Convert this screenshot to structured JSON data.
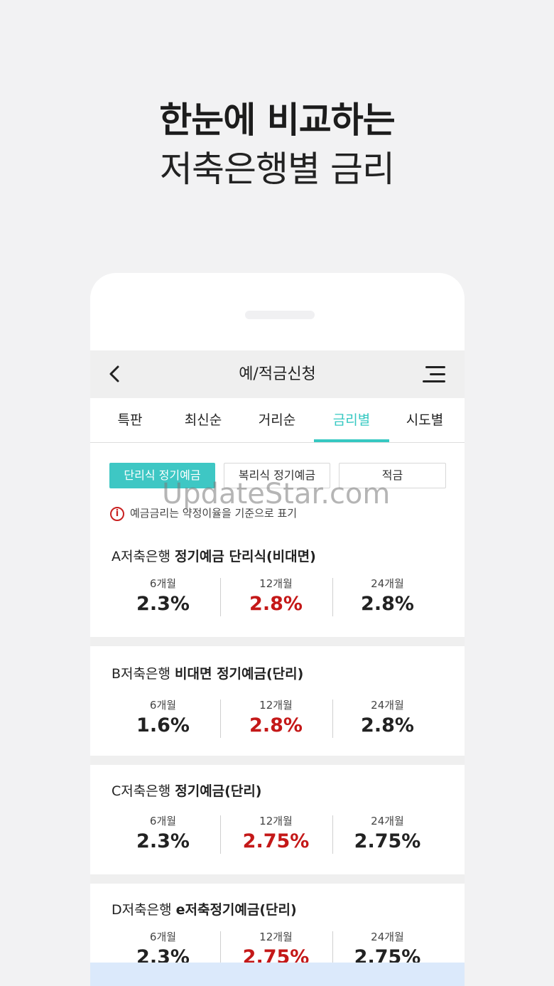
{
  "headline": {
    "line1": "한눈에 비교하는",
    "line2": "저축은행별 금리"
  },
  "appbar": {
    "title": "예/적금신청",
    "back_icon": "chevron-left-icon",
    "menu_icon": "hamburger-menu-icon"
  },
  "tabs": [
    {
      "label": "특판"
    },
    {
      "label": "최신순"
    },
    {
      "label": "거리순"
    },
    {
      "label": "금리별",
      "active": true
    },
    {
      "label": "시도별"
    }
  ],
  "filters": [
    {
      "label": "단리식 정기예금",
      "active": true
    },
    {
      "label": "복리식 정기예금"
    },
    {
      "label": "적금"
    }
  ],
  "notice": {
    "icon": "info-icon",
    "text": "예금금리는 약정이율을 기준으로 표기"
  },
  "accent_color": "#36c8c2",
  "highlight_color": "#c41818",
  "products": [
    {
      "bank": "A저축은행",
      "name": "정기예금 단리식(비대면)",
      "rates": [
        {
          "term": "6개월",
          "rate": "2.3%"
        },
        {
          "term": "12개월",
          "rate": "2.8%",
          "highlight": true
        },
        {
          "term": "24개월",
          "rate": "2.8%"
        }
      ]
    },
    {
      "bank": "B저축은행",
      "name": "비대면 정기예금(단리)",
      "rates": [
        {
          "term": "6개월",
          "rate": "1.6%"
        },
        {
          "term": "12개월",
          "rate": "2.8%",
          "highlight": true
        },
        {
          "term": "24개월",
          "rate": "2.8%"
        }
      ]
    },
    {
      "bank": "C저축은행",
      "name": "정기예금(단리)",
      "rates": [
        {
          "term": "6개월",
          "rate": "2.3%"
        },
        {
          "term": "12개월",
          "rate": "2.75%",
          "highlight": true
        },
        {
          "term": "24개월",
          "rate": "2.75%"
        }
      ]
    },
    {
      "bank": "D저축은행",
      "name": "e저축정기예금(단리)",
      "rates": [
        {
          "term": "6개월",
          "rate": "2.3%"
        },
        {
          "term": "12개월",
          "rate": "2.75%",
          "highlight": true
        },
        {
          "term": "24개월",
          "rate": "2.75%"
        }
      ]
    }
  ],
  "watermark": "UpdateStar.com"
}
